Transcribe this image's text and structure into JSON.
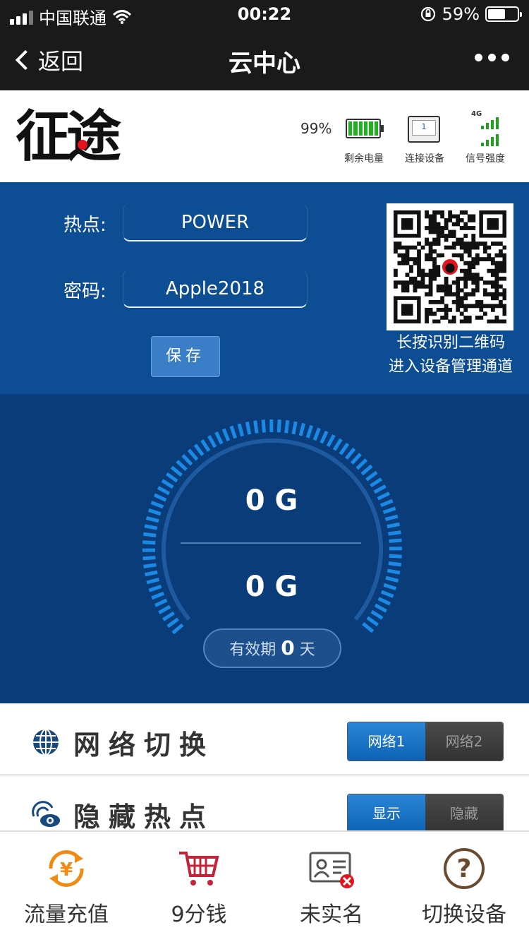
{
  "status_bar": {
    "carrier": "中国联通",
    "time": "00:22",
    "battery_percent": "59%",
    "battery_level": 0.59,
    "icons": [
      "signal-icon",
      "wifi-icon",
      "orientation-lock-icon",
      "battery-icon"
    ]
  },
  "nav": {
    "back_label": "返回",
    "title": "云中心",
    "more_icon": "more-dots-icon"
  },
  "header": {
    "logo_text": "征途",
    "battery_value": "99%",
    "battery_label": "剩余电量",
    "device_count": "1",
    "device_label": "连接设备",
    "signal_type": "4G",
    "signal_label": "信号强度"
  },
  "hotspot": {
    "ssid_label": "热点:",
    "ssid_value": "POWER",
    "password_label": "密码:",
    "password_value": "Apple2018",
    "save_label": "保存",
    "qr_caption_line1": "长按识别二维码",
    "qr_caption_line2": "进入设备管理通道"
  },
  "gauge": {
    "total_value": "0 G",
    "remaining_value": "0 G",
    "validity_prefix": "有效期",
    "validity_days": "0",
    "validity_suffix": "天"
  },
  "options": {
    "network": {
      "title": "网络切换",
      "opt1": "网络1",
      "opt2": "网络2",
      "selected": "网络1"
    },
    "hide_hotspot": {
      "title": "隐藏热点",
      "opt1": "显示",
      "opt2": "隐藏",
      "selected": "显示"
    }
  },
  "tabbar": {
    "tab1": "流量充值",
    "tab2": "9分钱",
    "tab3": "未实名",
    "tab4": "切换设备"
  },
  "colors": {
    "nav_bg": "#1a1a1a",
    "hotspot_bg": "#0c4d93",
    "gauge_bg": "#093c78",
    "gauge_ticks": "#1b8ae6",
    "toggle_on": "#1672c8",
    "recharge_orange": "#f08a12",
    "cart_red": "#c4243a",
    "unverified_red": "#e3141b",
    "switch_brown": "#6a4a2e"
  }
}
